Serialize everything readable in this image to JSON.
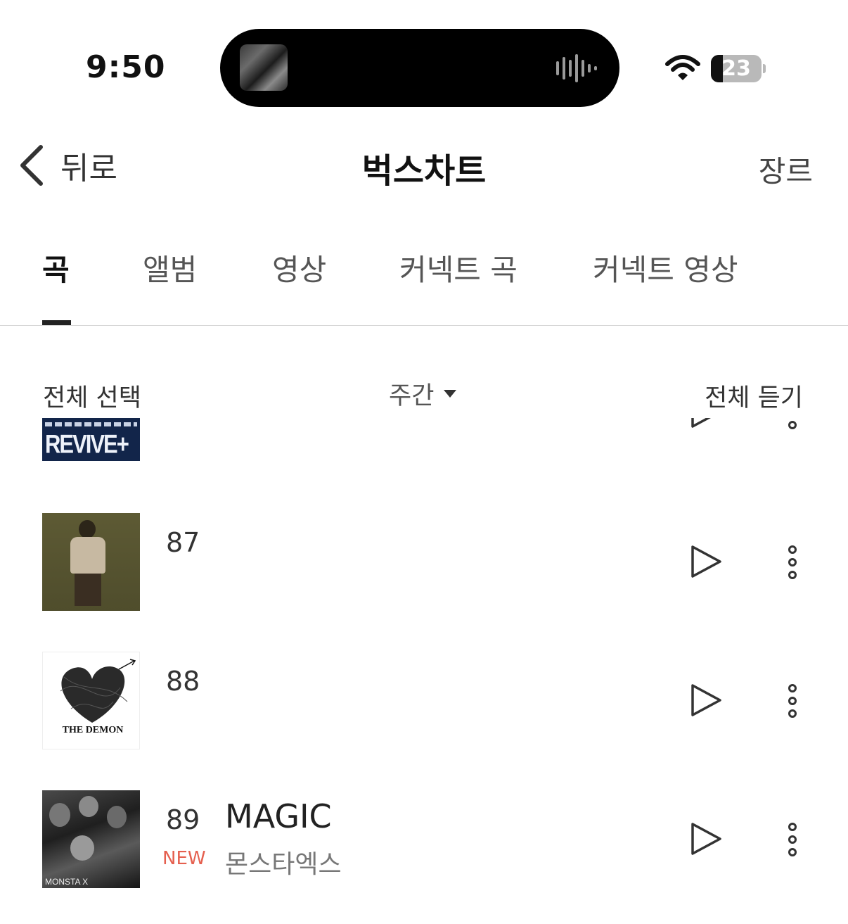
{
  "status_bar": {
    "time": "9:50",
    "battery": "23",
    "battery_level": 0.23
  },
  "nav": {
    "back_label": "뒤로",
    "title": "벅스차트",
    "genre_label": "장르"
  },
  "tabs": [
    {
      "label": "곡",
      "active": true
    },
    {
      "label": "앨범",
      "active": false
    },
    {
      "label": "영상",
      "active": false
    },
    {
      "label": "커넥트 곡",
      "active": false
    },
    {
      "label": "커넥트 영상",
      "active": false
    }
  ],
  "controls": {
    "select_all": "전체 선택",
    "period": "주간",
    "play_all": "전체 듣기"
  },
  "rows": [
    {
      "rank": "",
      "title": "",
      "artist": "",
      "badge": "",
      "art_text": "REVIVE+"
    },
    {
      "rank": "87",
      "title": "",
      "artist": "",
      "badge": "",
      "art_text": ""
    },
    {
      "rank": "88",
      "title": "",
      "artist": "",
      "badge": "",
      "art_text": "THE DEMON"
    },
    {
      "rank": "89",
      "title": "MAGIC",
      "artist": "몬스타엑스",
      "badge": "NEW",
      "art_text": "MONSTA X"
    }
  ]
}
